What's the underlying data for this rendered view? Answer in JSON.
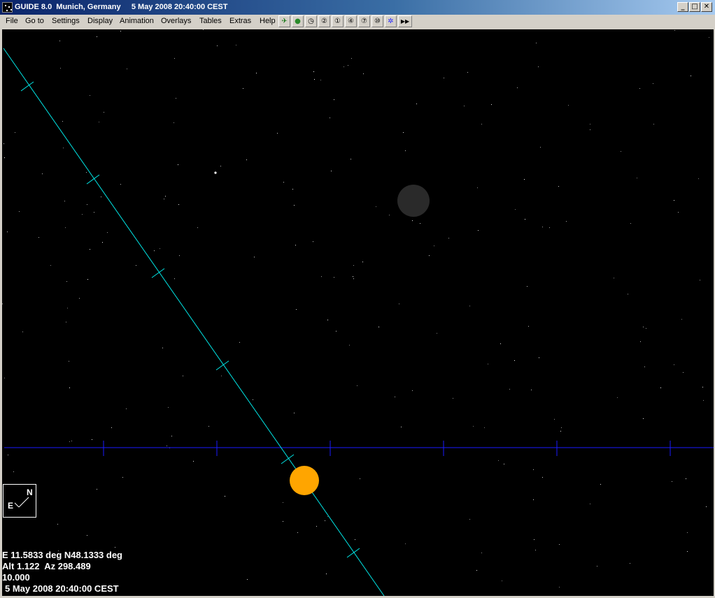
{
  "window": {
    "title": "GUIDE 8.0  Munich, Germany     5 May 2008 20:40:00 CEST",
    "minimize_glyph": "_",
    "maximize_glyph": "□",
    "close_glyph": "✕"
  },
  "menu": [
    "File",
    "Go to",
    "Settings",
    "Display",
    "Animation",
    "Overlays",
    "Tables",
    "Extras",
    "Help"
  ],
  "toolbar": [
    {
      "icon": "telescope-icon",
      "glyph": "✈"
    },
    {
      "icon": "planet-icon",
      "glyph": "●"
    },
    {
      "icon": "clock-icon",
      "glyph": "◷"
    },
    {
      "icon": "zoom-2-icon",
      "glyph": "②"
    },
    {
      "icon": "zoom-1-icon",
      "glyph": "①"
    },
    {
      "icon": "zoom-4-icon",
      "glyph": "④"
    },
    {
      "icon": "zoom-7-icon",
      "glyph": "⑦"
    },
    {
      "icon": "zoom-10-icon",
      "glyph": "⑩"
    },
    {
      "icon": "star-field-icon",
      "glyph": "✲"
    },
    {
      "icon": "fast-forward-icon",
      "glyph": "▶▶"
    }
  ],
  "colors": {
    "sky": "#000000",
    "ecliptic": "#00e5e5",
    "horizon": "#1a1aff",
    "sun": "#ffa500",
    "moon": "#2a2a2a"
  },
  "compass": {
    "north": "N",
    "east": "E"
  },
  "status": {
    "location": "E 11.5833 deg N48.1333 deg",
    "altaz": "Alt 1.122  Az 298.489",
    "field": "10.000",
    "datetime": "5 May 2008 20:40:00 CEST"
  }
}
